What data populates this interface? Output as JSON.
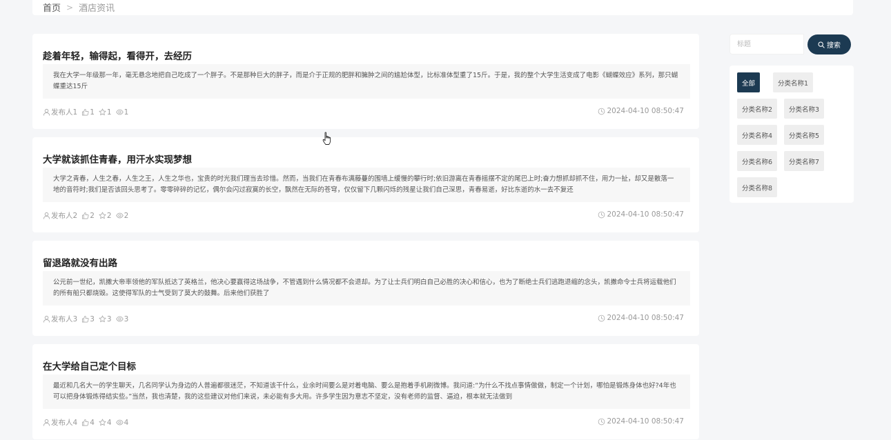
{
  "breadcrumb": {
    "home": "首页",
    "separator": ">",
    "current": "酒店资讯"
  },
  "articles": [
    {
      "title": "趁着年轻，输得起，看得开，去经历",
      "excerpt": "我在大学一年级那一年，毫无悬念地把自己吃成了一个胖子。不是那种巨大的胖子，而是介于正规的肥胖和臃肿之间的尴尬体型，比标准体型重了15斤。于是，我的整个大学生活变成了电影《蝴蝶效应》系列，那只蝴蝶重达15斤",
      "author": "发布人1",
      "likes": "1",
      "favorites": "1",
      "views": "1",
      "time": "2024-04-10 08:50:47"
    },
    {
      "title": "大学就该抓住青春，用汗水实现梦想",
      "excerpt": "大学之青春，人生之春，人生之王，人生之华也，宝贵的时光我们理当去珍惜。然而，当我们在青春布满藤蔓的围墙上缓慢的攀行时;依旧游离在青春摇摆不定的尾巴上时;奋力想抓却抓不住，用力一扯，却又是散落一地的音符时;我们是否该回头思考了。零零碎碎的记忆，偶尔会闪过寂寞的长空，飘然在无际的苍穹，仅仅留下几颗闪烁的残星让我们自己深思，青春易逝，好比东逝的水一去不复还",
      "author": "发布人2",
      "likes": "2",
      "favorites": "2",
      "views": "2",
      "time": "2024-04-10 08:50:47"
    },
    {
      "title": "留退路就没有出路",
      "excerpt": "公元前一世纪，凯撒大帝率领他的军队抵达了英格兰，他决心要赢得这场战争，不管遇到什么情况都不会退却。为了让士兵们明白自己必胜的决心和信心，也为了断绝士兵们逃跑退缩的念头，凯撒命令士兵将运载他们的所有船只都烧毁。这使得军队的士气受到了莫大的鼓舞。后来他们获胜了",
      "author": "发布人3",
      "likes": "3",
      "favorites": "3",
      "views": "3",
      "time": "2024-04-10 08:50:47"
    },
    {
      "title": "在大学给自己定个目标",
      "excerpt": "最近和几名大一的学生聊天，几名同学认为身边的人普遍都很迷茫，不知道该干什么，业余时间要么是对着电脑、要么是抱着手机刷微博。我问道:“为什么不找点事情做做，制定一个计划，哪怕是锻炼身体也好?4年也可以把身体锻炼得结实些。”当然，我也清楚，我的这些建议对他们来说，未必能有多大用。许多学生因为意志不坚定，没有老师的监督、逼迫，根本就无法做到",
      "author": "发布人4",
      "likes": "4",
      "favorites": "4",
      "views": "4",
      "time": "2024-04-10 08:50:47"
    }
  ],
  "search": {
    "placeholder": "标题",
    "value": "",
    "button_label": "搜索"
  },
  "categories": [
    {
      "label": "全部",
      "active": true
    },
    {
      "label": "分类名称1"
    },
    {
      "label": "分类名称2"
    },
    {
      "label": "分类名称3"
    },
    {
      "label": "分类名称4"
    },
    {
      "label": "分类名称5"
    },
    {
      "label": "分类名称6"
    },
    {
      "label": "分类名称7"
    },
    {
      "label": "分类名称8"
    }
  ],
  "icons": {
    "author": "user-icon",
    "likes": "thumbs-up-icon",
    "favorites": "star-icon",
    "views": "eye-icon",
    "time": "clock-icon",
    "search": "search-icon"
  },
  "colors": {
    "accent": "#1c3a52",
    "background": "#f5f6f8"
  }
}
